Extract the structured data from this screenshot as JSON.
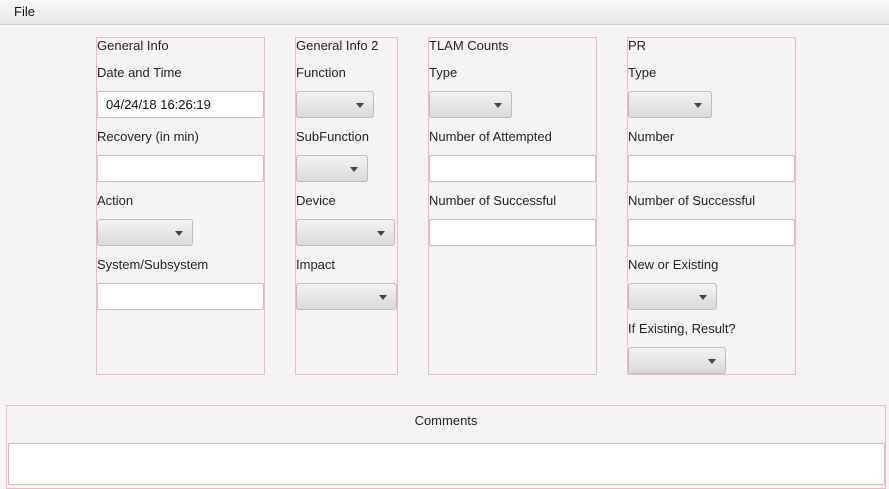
{
  "menu": {
    "file": "File"
  },
  "general_info": {
    "title": "General Info",
    "date_time_label": "Date and Time",
    "date_time_value": "04/24/18 16:26:19",
    "recovery_label": "Recovery (in min)",
    "recovery_value": "",
    "action_label": "Action",
    "system_label": "System/Subsystem",
    "system_value": ""
  },
  "general_info_2": {
    "title": "General Info 2",
    "function_label": "Function",
    "subfunction_label": "SubFunction",
    "device_label": "Device",
    "impact_label": "Impact"
  },
  "tlam_counts": {
    "title": "TLAM Counts",
    "type_label": "Type",
    "attempted_label": "Number of Attempted",
    "attempted_value": "",
    "successful_label": "Number of Successful",
    "successful_value": ""
  },
  "pr": {
    "title": "PR",
    "type_label": "Type",
    "number_label": "Number",
    "number_value": "",
    "successful_label": "Number of Successful",
    "successful_value": "",
    "new_existing_label": "New or Existing",
    "result_label": "If Existing, Result?"
  },
  "comments": {
    "title": "Comments",
    "value": ""
  }
}
